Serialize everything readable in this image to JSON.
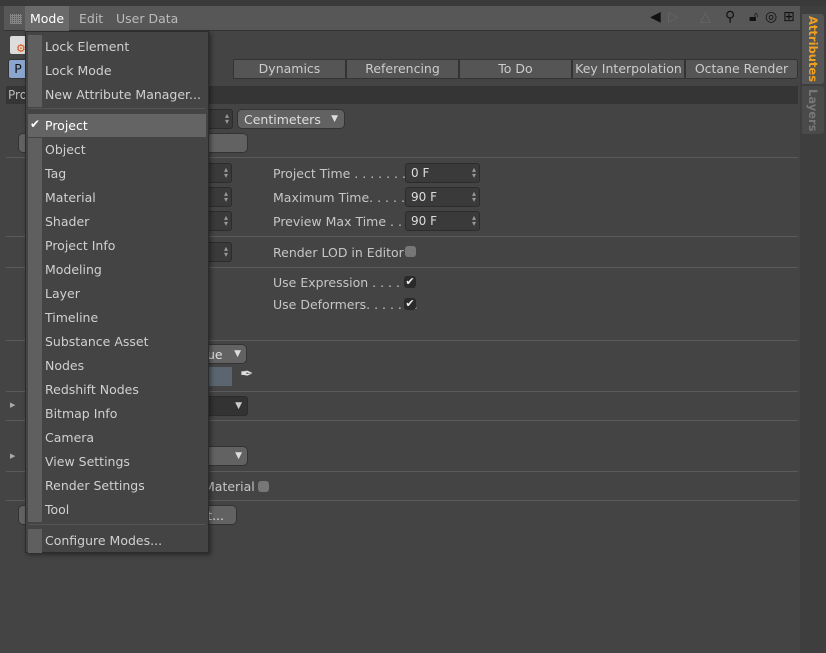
{
  "menubar": {
    "items": [
      "Mode",
      "Edit",
      "User Data"
    ]
  },
  "toolbar_icons": [
    "back-arrow-icon",
    "forward-arrow-icon",
    "up-arrow-icon",
    "search-icon",
    "lock-icon",
    "target-icon",
    "new-panel-icon"
  ],
  "sidebar": {
    "tabs": [
      {
        "label": "Attributes",
        "active": true,
        "color": "#f0a020"
      },
      {
        "label": "Layers",
        "active": false
      }
    ]
  },
  "tabs": [
    "P",
    "Dynamics",
    "Referencing",
    "To Do",
    "Key Interpolation",
    "Octane Render"
  ],
  "path_label": "Pro",
  "fields": {
    "units": "Centimeters",
    "project_time": {
      "label": "Project Time . . . . . . . . .",
      "value": "0 F"
    },
    "maximum_time": {
      "label": "Maximum Time. . . . . .",
      "value": "90 F"
    },
    "preview_max_time": {
      "label": "Preview Max Time . . .",
      "value": "90 F"
    },
    "render_lod": {
      "label": "Render LOD in Editor",
      "checked": false
    },
    "use_expression": {
      "label": "Use Expression . . . . . .",
      "checked": true
    },
    "use_deformers": {
      "label": "Use Deformers. . . . . . .",
      "checked": true
    },
    "color_dropdown_partial": "ue",
    "material_partial": "Material",
    "button_partial": "t..."
  },
  "menu": {
    "top": [
      "Lock Element",
      "Lock Mode",
      "New Attribute Manager..."
    ],
    "modes": [
      "Project",
      "Object",
      "Tag",
      "Material",
      "Shader",
      "Project Info",
      "Modeling",
      "Layer",
      "Timeline",
      "Substance Asset",
      "Nodes",
      "Redshift Nodes",
      "Bitmap Info",
      "Camera",
      "View Settings",
      "Render Settings",
      "Tool"
    ],
    "selected": "Project",
    "bottom": [
      "Configure Modes..."
    ]
  }
}
